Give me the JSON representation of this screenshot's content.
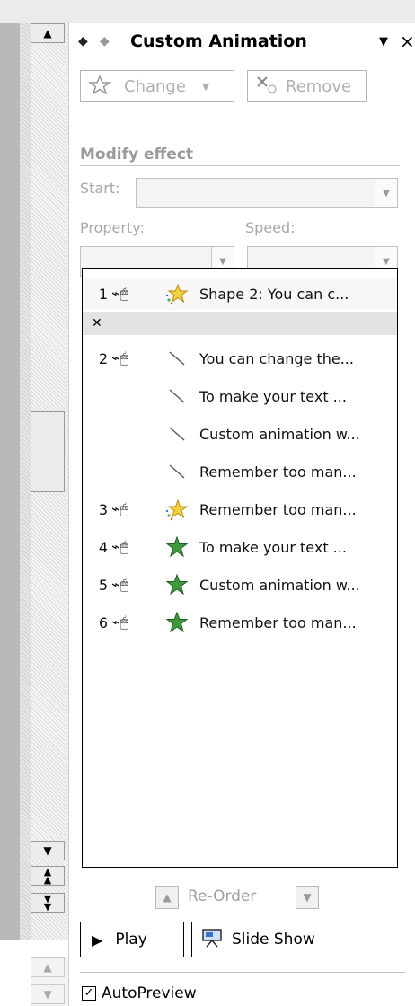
{
  "pane": {
    "title": "Custom Animation",
    "change_label": "Change",
    "remove_label": "Remove",
    "section_heading": "Modify effect",
    "start_label": "Start:",
    "property_label": "Property:",
    "speed_label": "Speed:",
    "reorder_label": "Re-Order",
    "play_label": "Play",
    "slideshow_label": "Slide Show",
    "autopreview_label": "AutoPreview",
    "autopreview_checked": true,
    "colors": {
      "accent_green": "#3c9a3c",
      "star_yellow": "#f4d23a"
    }
  },
  "effects": [
    {
      "num": "1",
      "text": "Shape 2: You can c...",
      "icon": "star-sparkle-icon"
    },
    {
      "num": "2",
      "text": "You can change the...",
      "icon": "line-icon"
    },
    {
      "num": "",
      "text": "To make your text ...",
      "icon": "line-icon"
    },
    {
      "num": "",
      "text": "Custom animation w...",
      "icon": "line-icon"
    },
    {
      "num": "",
      "text": "Remember too man...",
      "icon": "line-icon"
    },
    {
      "num": "3",
      "text": "Remember too man...",
      "icon": "star-sparkle-icon"
    },
    {
      "num": "4",
      "text": "To make your text ...",
      "icon": "green-star-icon"
    },
    {
      "num": "5",
      "text": "Custom animation w...",
      "icon": "green-star-icon"
    },
    {
      "num": "6",
      "text": "Remember too man...",
      "icon": "green-star-icon"
    }
  ]
}
